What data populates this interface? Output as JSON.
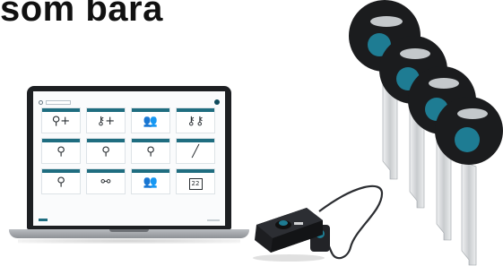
{
  "headline": "som bara",
  "laptop_screen": {
    "tiles": [
      {
        "icon": "key-add-icon"
      },
      {
        "icon": "keys-add-icon"
      },
      {
        "icon": "users-add-icon"
      },
      {
        "icon": "keys-icon"
      },
      {
        "icon": "key-icon"
      },
      {
        "icon": "key-icon"
      },
      {
        "icon": "key-icon"
      },
      {
        "icon": "pen-icon"
      },
      {
        "icon": "key-icon"
      },
      {
        "icon": "cable-icon"
      },
      {
        "icon": "users-icon"
      },
      {
        "icon": "calendar-icon"
      }
    ],
    "calendar_day": "22"
  },
  "colors": {
    "tile_header": "#1f6d80",
    "key_head": "#1b1c1e",
    "key_insert": "#1e7c93"
  }
}
